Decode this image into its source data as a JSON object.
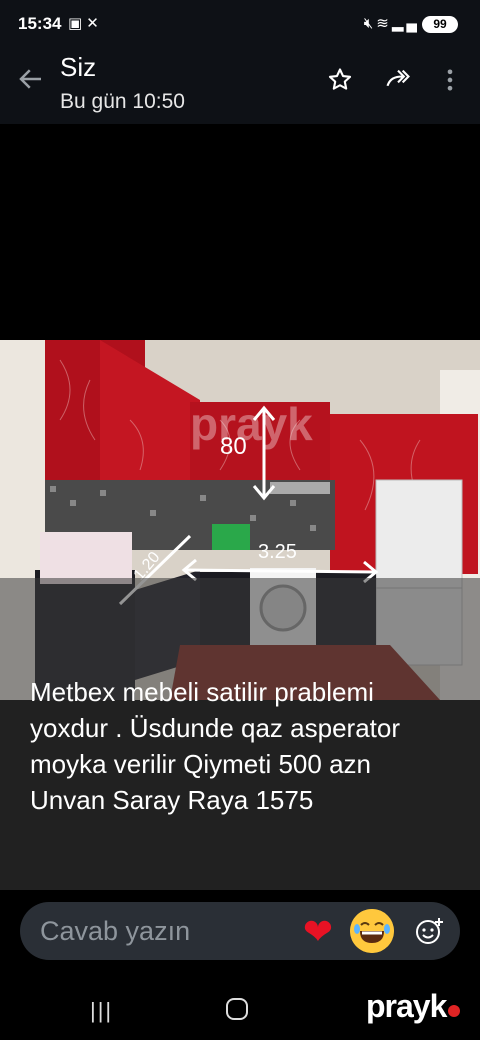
{
  "status_bar": {
    "time": "15:34",
    "left_icons": [
      "screenshot-icon",
      "missed-call-icon"
    ],
    "right_icons": [
      "mute-icon",
      "wifi-icon",
      "signal-icon"
    ],
    "battery": "99"
  },
  "header": {
    "title": "Siz",
    "subtitle": "Bu gün 10:50",
    "actions": [
      "star-icon",
      "forward-icon",
      "more-icon"
    ]
  },
  "photo": {
    "watermark": "prayk",
    "measurements": [
      "80",
      "3.25",
      "1.20"
    ]
  },
  "caption": "Metbex mebeli satilir prablemi yoxdur .  Üsdunde qaz asperator moyka verilir Qiymeti 500 azn Unvan Saray Raya 1575",
  "reply": {
    "placeholder": "Cavab yazın",
    "reactions": [
      "heart-emoji",
      "laughing-emoji"
    ]
  },
  "nav": {
    "brand": "prayk"
  },
  "colors": {
    "background": "#000000",
    "header": "#0e1116",
    "reply_bar": "#2a2f36",
    "heart": "#e81224",
    "brand_dot": "#e02424"
  }
}
